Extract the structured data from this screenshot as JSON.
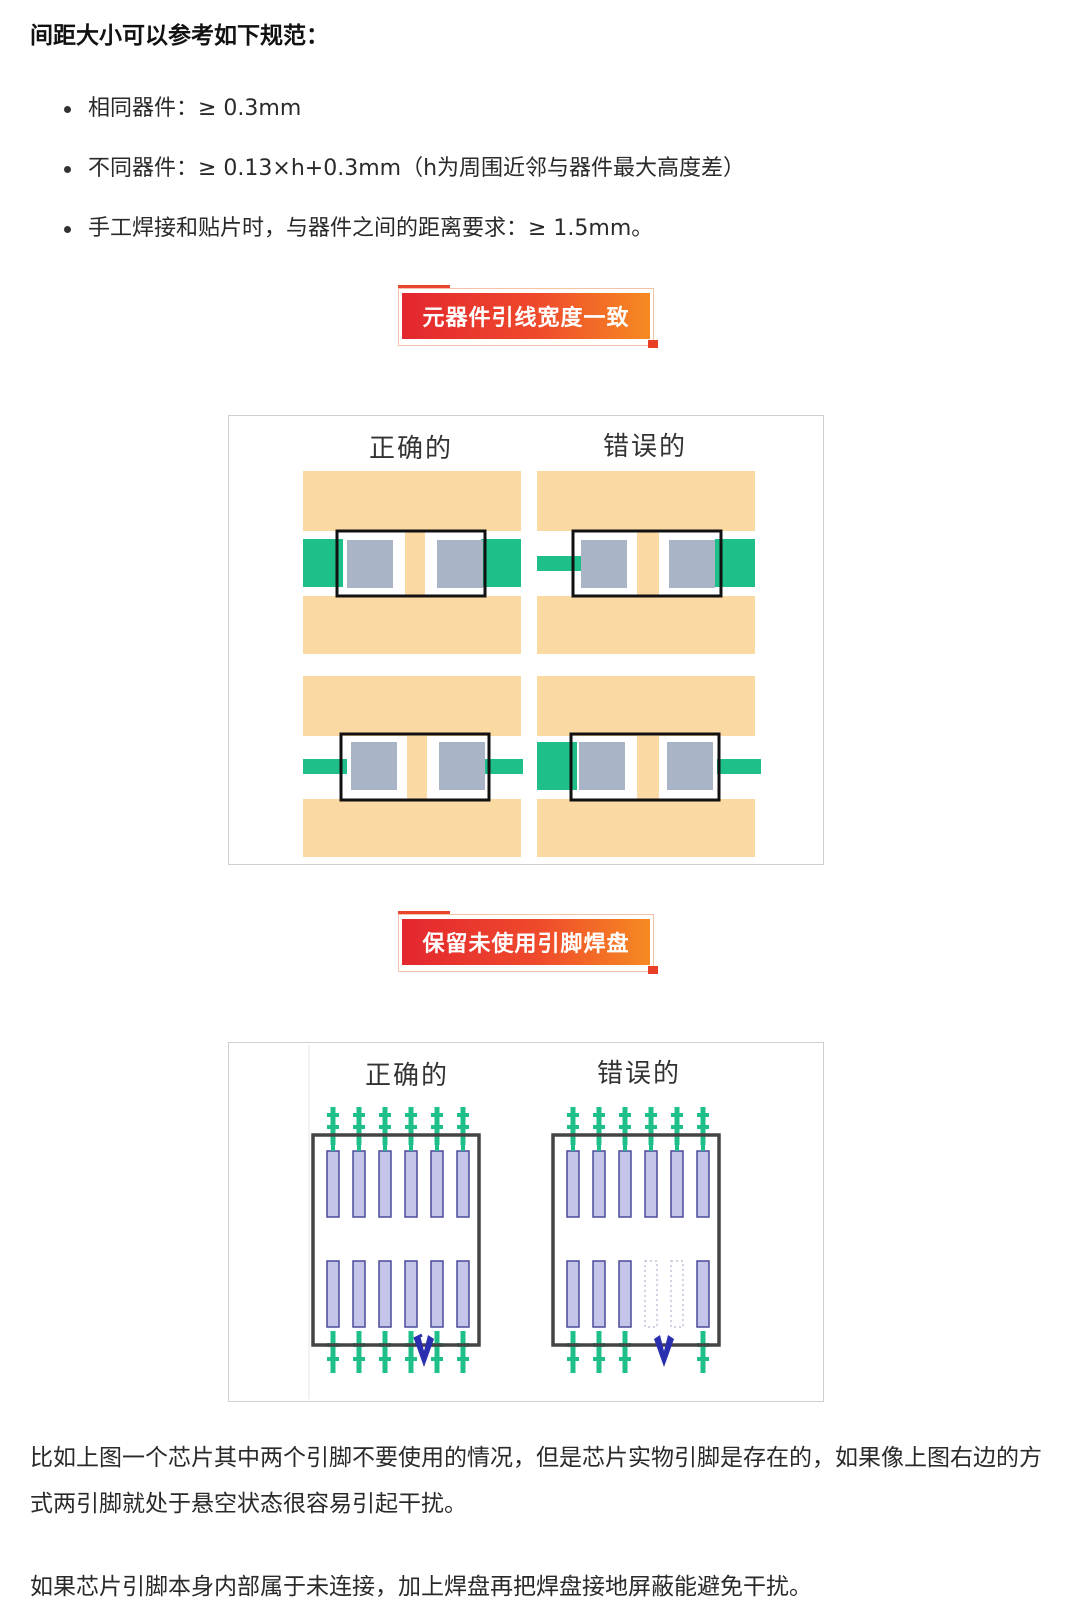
{
  "heading": "间距大小可以参考如下规范：",
  "rules": [
    "相同器件：≥ 0.3mm",
    "不同器件：≥ 0.13×h+0.3mm（h为周围近邻与器件最大高度差）",
    "手工焊接和贴片时，与器件之间的距离要求：≥ 1.5mm。"
  ],
  "section1": {
    "title": "元器件引线宽度一致",
    "figure": {
      "correct_label": "正确的",
      "wrong_label": "错误的"
    }
  },
  "section2": {
    "title": "保留未使用引脚焊盘",
    "figure": {
      "correct_label": "正确的",
      "wrong_label": "错误的"
    }
  },
  "paragraphs": [
    "比如上图一个芯片其中两个引脚不要使用的情况，但是芯片实物引脚是存在的，如果像上图右边的方式两引脚就处于悬空状态很容易引起干扰。",
    "如果芯片引脚本身内部属于未连接，加上焊盘再把焊盘接地屏蔽能避免干扰。"
  ],
  "colors": {
    "copper": "#fad9a3",
    "trace": "#1fbf8a",
    "pad": "#a9b4c6",
    "chip_pad": "#c5c5ea",
    "brand_red": "#e3262e",
    "brand_orange": "#f68a22",
    "jumper": "#2a2fb0"
  }
}
